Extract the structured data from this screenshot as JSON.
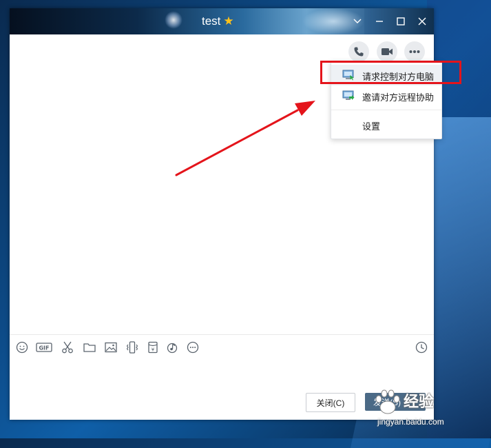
{
  "window": {
    "title": "test",
    "star_icon": "star-icon",
    "controls": [
      "chevron-down-icon",
      "minimize-icon",
      "maximize-icon",
      "close-icon"
    ]
  },
  "header_actions": [
    {
      "name": "phone-call",
      "icon": "phone-icon"
    },
    {
      "name": "video-call",
      "icon": "video-camera-icon"
    },
    {
      "name": "more",
      "icon": "more-dots-icon"
    }
  ],
  "menu": {
    "items": [
      {
        "label": "请求控制对方电脑",
        "icon": "remote-control-icon"
      },
      {
        "label": "邀请对方远程协助",
        "icon": "remote-assist-icon"
      },
      {
        "label": "设置",
        "icon": ""
      }
    ]
  },
  "toolbar": {
    "tools": [
      "emoji-icon",
      "gif-icon",
      "scissors-icon",
      "folder-icon",
      "image-icon",
      "shake-icon",
      "red-packet-icon",
      "music-icon",
      "more-icon"
    ],
    "history_icon": "clock-icon"
  },
  "footer": {
    "close_label": "关闭(C)",
    "send_label": "发送(S)"
  },
  "watermark": {
    "text": "经验",
    "url": "jingyan.baidu.com"
  },
  "colors": {
    "highlight": "#e4141b",
    "send_button": "#4b6a86",
    "star": "#ffc21a"
  }
}
